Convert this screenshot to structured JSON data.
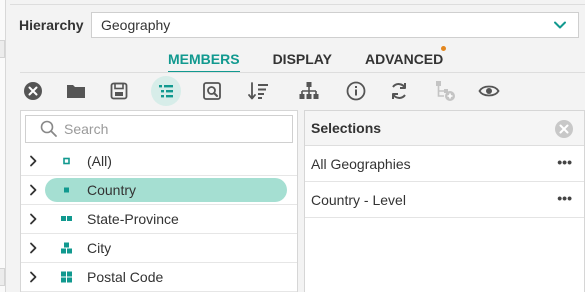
{
  "hierarchy": {
    "label": "Hierarchy",
    "selected_value": "Geography"
  },
  "tabs": [
    {
      "label": "MEMBERS",
      "active": true
    },
    {
      "label": "DISPLAY",
      "active": false
    },
    {
      "label": "ADVANCED",
      "active": false,
      "has_indicator": true
    }
  ],
  "toolbar": {
    "icons": [
      "close-circle-icon",
      "folder-icon",
      "save-icon",
      "list-view-icon",
      "search-members-icon",
      "sort-icon",
      "hierarchy-tree-icon",
      "info-icon",
      "refresh-icon",
      "add-child-icon",
      "eye-icon"
    ],
    "selected": "list-view-icon"
  },
  "search": {
    "placeholder": "Search"
  },
  "tree": {
    "items": [
      {
        "label": "(All)",
        "icon": "all-level-icon"
      },
      {
        "label": "Country",
        "icon": "country-level-icon",
        "selected": true
      },
      {
        "label": "State-Province",
        "icon": "state-level-icon"
      },
      {
        "label": "City",
        "icon": "city-level-icon"
      },
      {
        "label": "Postal Code",
        "icon": "postal-level-icon"
      }
    ]
  },
  "selections": {
    "title": "Selections",
    "items": [
      {
        "label": "All Geographies"
      },
      {
        "label": "Country - Level"
      }
    ],
    "more_label": "•••"
  },
  "colors": {
    "accent": "#11998f",
    "selection_pill": "#a5dfd2",
    "indicator": "#e3871f"
  }
}
